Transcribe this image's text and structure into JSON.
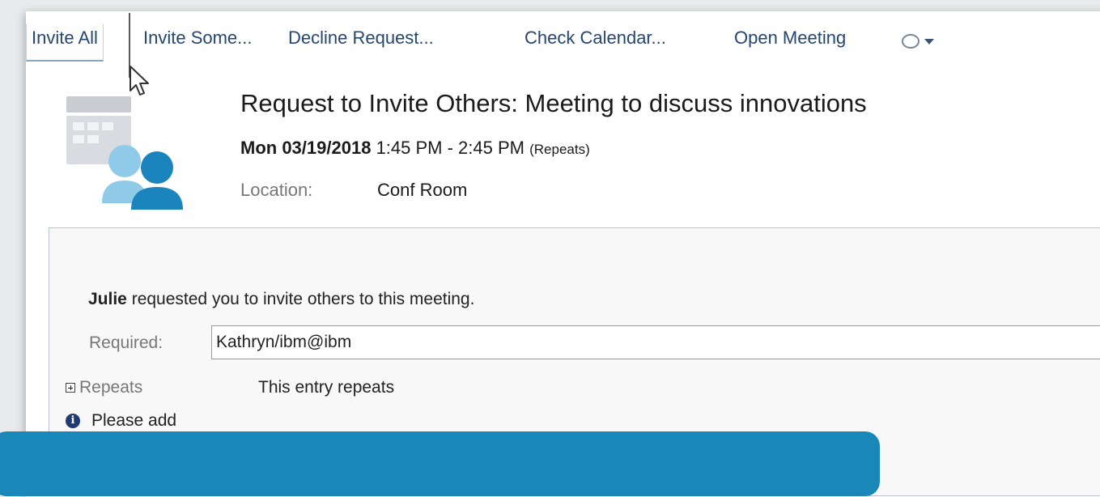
{
  "toolbar": {
    "invite_all": "Invite All",
    "invite_some": "Invite Some...",
    "decline_request": "Decline Request...",
    "check_calendar": "Check Calendar...",
    "open_meeting": "Open Meeting"
  },
  "meeting": {
    "title": "Request to Invite Others: Meeting to discuss innovations",
    "date": "Mon 03/19/2018",
    "time": "1:45 PM - 2:45 PM",
    "repeats_note": "(Repeats)",
    "location_label": "Location:",
    "location_value": "Conf Room"
  },
  "body": {
    "requester": "Julie",
    "request_text": "requested you to invite others to this meeting.",
    "required_label": "Required:",
    "required_value": "Kathryn/ibm@ibm",
    "repeats_label": "Repeats",
    "repeats_value": "This entry repeats",
    "info_text": "Please add"
  },
  "colors": {
    "toolbar_text": "#24466f",
    "banner": "#1a87b9",
    "icon_light_blue": "#8fcbe9",
    "icon_dark_blue": "#1b84bd",
    "info_icon": "#1f3b73"
  },
  "icons": {
    "meeting_icon": "calendar-people-icon",
    "chat": "chat-bubble-icon",
    "dropdown": "caret-down-icon",
    "info": "info-icon",
    "expand": "expand-plus-icon",
    "cursor": "mouse-pointer-icon"
  }
}
